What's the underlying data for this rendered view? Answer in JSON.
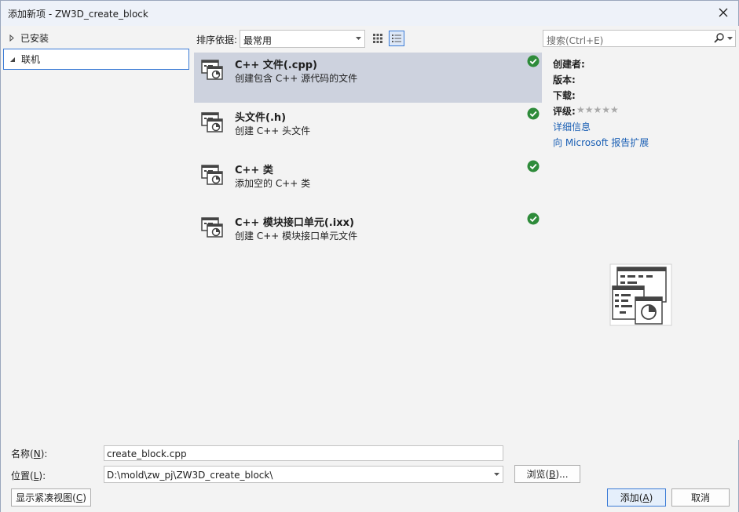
{
  "window": {
    "title": "添加新项 - ZW3D_create_block"
  },
  "tree": {
    "items": [
      {
        "label": "已安装",
        "expanded": false
      },
      {
        "label": "联机",
        "expanded": true
      }
    ]
  },
  "sortbar": {
    "label": "排序依据:",
    "selected": "最常用"
  },
  "templates": [
    {
      "name": "C++ 文件(.cpp)",
      "desc": "创建包含 C++ 源代码的文件"
    },
    {
      "name": "头文件(.h)",
      "desc": "创建 C++ 头文件"
    },
    {
      "name": "C++ 类",
      "desc": "添加空的 C++ 类"
    },
    {
      "name": "C++ 模块接口单元(.ixx)",
      "desc": "创建 C++ 模块接口单元文件"
    }
  ],
  "details": {
    "search_placeholder": "搜索(Ctrl+E)",
    "author_label": "创建者:",
    "version_label": "版本:",
    "downloads_label": "下载:",
    "rating_label": "评级:",
    "rating_stars": "★★★★★",
    "more_info_link": "详细信息",
    "report_link": "向 Microsoft 报告扩展"
  },
  "form": {
    "name_label": "名称",
    "name_key": "N",
    "name_value": "create_block.cpp",
    "location_label": "位置",
    "location_key": "L",
    "location_value": "D:\\mold\\zw_pj\\ZW3D_create_block\\",
    "browse_label": "浏览",
    "browse_key": "B",
    "compact_label": "显示紧凑视图",
    "compact_key": "C",
    "add_label": "添加",
    "add_key": "A",
    "cancel_label": "取消"
  },
  "colors": {
    "accent": "#3b7bd6",
    "link": "#1a5fb4",
    "check": "#2e8b3a",
    "selected_row": "#cdd2de"
  }
}
